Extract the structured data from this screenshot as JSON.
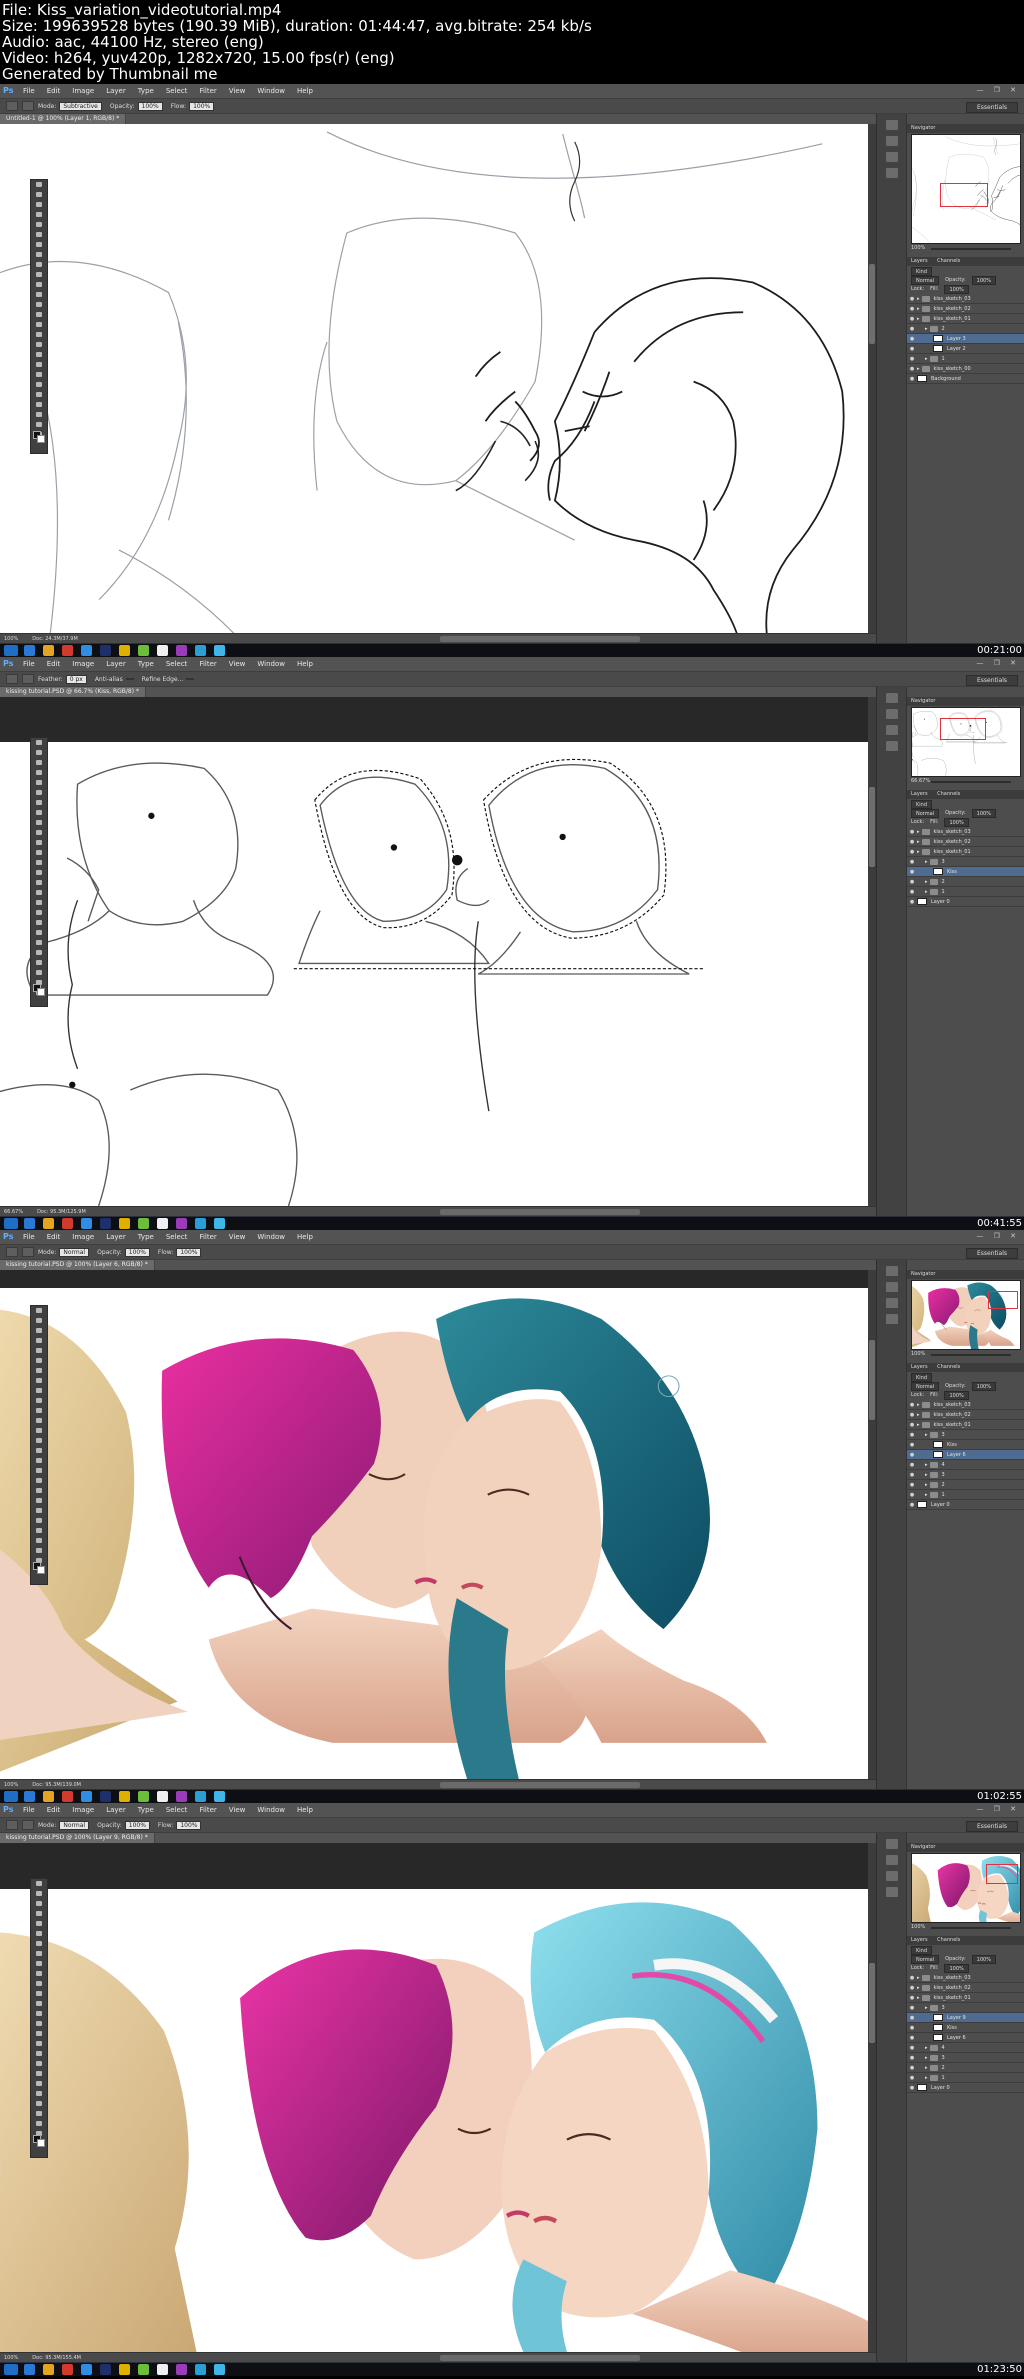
{
  "info": {
    "file": "File: Kiss_variation_videotutorial.mp4",
    "size": "Size: 199639528 bytes (190.39 MiB), duration: 01:44:47, avg.bitrate: 254 kb/s",
    "audio": "Audio: aac, 44100 Hz, stereo (eng)",
    "video": "Video: h264, yuv420p, 1282x720, 15.00 fps(r) (eng)",
    "generator": "Generated by Thumbnail me"
  },
  "menu": [
    "File",
    "Edit",
    "Image",
    "Layer",
    "Type",
    "Select",
    "Filter",
    "View",
    "Window",
    "Help"
  ],
  "app_logo": "Ps",
  "window_buttons": "— ❐ ✕",
  "workspace": "Essentials",
  "panel_tabs": {
    "navigator": "Navigator",
    "layers": "Layers",
    "channels": "Channels"
  },
  "layer_controls": {
    "kind": "Kind",
    "normal": "Normal",
    "opacity": "Opacity:",
    "opacity_val": "100%",
    "lock": "Lock:",
    "fill": "Fill:",
    "fill_val": "100%"
  },
  "taskbar_icon_colors": [
    "#2a7ad5",
    "#e3a520",
    "#d23a2e",
    "#2f8de4",
    "#1e2f6a",
    "#e0b000",
    "#6bbd3a",
    "#f0f0f0",
    "#9a3bb8",
    "#2a9fd6",
    "#3fb5e8"
  ],
  "frames": [
    {
      "timestamp": "00:21:00",
      "doc_tab": "Untitled-1 @ 100% (Layer 1, RGB/8) *",
      "options": {
        "mode_label": "Mode:",
        "mode_value": "Subtractive",
        "opacity_label": "Opacity:",
        "opacity_value": "100%",
        "flow_label": "Flow:",
        "flow_value": "100%"
      },
      "status": {
        "zoom": "100%",
        "doc": "Doc: 24.3M/37.9M"
      },
      "layers": [
        {
          "name": "kiss_sketch_03",
          "kind": "folder",
          "indent": 0,
          "selected": false
        },
        {
          "name": "kiss_sketch_02",
          "kind": "folder",
          "indent": 0,
          "selected": false
        },
        {
          "name": "kiss_sketch_01",
          "kind": "folder",
          "indent": 0,
          "selected": false
        },
        {
          "name": "2",
          "kind": "folder",
          "indent": 1,
          "selected": false
        },
        {
          "name": "Layer 3",
          "kind": "layer",
          "indent": 2,
          "selected": true
        },
        {
          "name": "Layer 2",
          "kind": "layer",
          "indent": 2,
          "selected": false
        },
        {
          "name": "1",
          "kind": "folder",
          "indent": 1,
          "selected": false
        },
        {
          "name": "kiss_sketch_00",
          "kind": "folder",
          "indent": 0,
          "selected": false
        },
        {
          "name": "Background",
          "kind": "layer",
          "indent": 0,
          "selected": false
        }
      ],
      "nav_zoom": "100%"
    },
    {
      "timestamp": "00:41:55",
      "doc_tab": "kissing tutorial.PSD @ 66.7% (Kiss, RGB/8) *",
      "options": {
        "mode_label": "Feather:",
        "mode_value": "0 px",
        "opacity_label": "Anti-alias",
        "opacity_value": "",
        "flow_label": "Refine Edge...",
        "flow_value": ""
      },
      "status": {
        "zoom": "66.67%",
        "doc": "Doc: 95.3M/125.9M"
      },
      "layers": [
        {
          "name": "kiss_sketch_03",
          "kind": "folder",
          "indent": 0,
          "selected": false
        },
        {
          "name": "kiss_sketch_02",
          "kind": "folder",
          "indent": 0,
          "selected": false
        },
        {
          "name": "kiss_sketch_01",
          "kind": "folder",
          "indent": 0,
          "selected": false
        },
        {
          "name": "3",
          "kind": "folder",
          "indent": 1,
          "selected": false
        },
        {
          "name": "Kiss",
          "kind": "layer",
          "indent": 2,
          "selected": true
        },
        {
          "name": "2",
          "kind": "folder",
          "indent": 1,
          "selected": false
        },
        {
          "name": "1",
          "kind": "folder",
          "indent": 1,
          "selected": false
        },
        {
          "name": "Layer 0",
          "kind": "layer",
          "indent": 0,
          "selected": false
        }
      ],
      "nav_zoom": "66.67%"
    },
    {
      "timestamp": "01:02:55",
      "doc_tab": "kissing tutorial.PSD @ 100% (Layer 6, RGB/8) *",
      "options": {
        "mode_label": "Mode:",
        "mode_value": "Normal",
        "opacity_label": "Opacity:",
        "opacity_value": "100%",
        "flow_label": "Flow:",
        "flow_value": "100%"
      },
      "status": {
        "zoom": "100%",
        "doc": "Doc: 95.3M/139.0M"
      },
      "layers": [
        {
          "name": "kiss_sketch_03",
          "kind": "folder",
          "indent": 0,
          "selected": false
        },
        {
          "name": "kiss_sketch_02",
          "kind": "folder",
          "indent": 0,
          "selected": false
        },
        {
          "name": "kiss_sketch_01",
          "kind": "folder",
          "indent": 0,
          "selected": false
        },
        {
          "name": "3",
          "kind": "folder",
          "indent": 1,
          "selected": false
        },
        {
          "name": "Kiss",
          "kind": "layer",
          "indent": 2,
          "selected": false
        },
        {
          "name": "Layer 6",
          "kind": "layer",
          "indent": 2,
          "selected": true
        },
        {
          "name": "4",
          "kind": "folder",
          "indent": 1,
          "selected": false
        },
        {
          "name": "3",
          "kind": "folder",
          "indent": 1,
          "selected": false
        },
        {
          "name": "2",
          "kind": "folder",
          "indent": 1,
          "selected": false
        },
        {
          "name": "1",
          "kind": "folder",
          "indent": 1,
          "selected": false
        },
        {
          "name": "Layer 0",
          "kind": "layer",
          "indent": 0,
          "selected": false
        }
      ],
      "nav_zoom": "100%"
    },
    {
      "timestamp": "01:23:50",
      "doc_tab": "kissing tutorial.PSD @ 100% (Layer 9, RGB/8) *",
      "options": {
        "mode_label": "Mode:",
        "mode_value": "Normal",
        "opacity_label": "Opacity:",
        "opacity_value": "100%",
        "flow_label": "Flow:",
        "flow_value": "100%"
      },
      "status": {
        "zoom": "100%",
        "doc": "Doc: 95.3M/155.4M"
      },
      "layers": [
        {
          "name": "kiss_sketch_03",
          "kind": "folder",
          "indent": 0,
          "selected": false
        },
        {
          "name": "kiss_sketch_02",
          "kind": "folder",
          "indent": 0,
          "selected": false
        },
        {
          "name": "kiss_sketch_01",
          "kind": "folder",
          "indent": 0,
          "selected": false
        },
        {
          "name": "3",
          "kind": "folder",
          "indent": 1,
          "selected": false
        },
        {
          "name": "Layer 9",
          "kind": "layer",
          "indent": 2,
          "selected": true
        },
        {
          "name": "Kiss",
          "kind": "layer",
          "indent": 2,
          "selected": false
        },
        {
          "name": "Layer 6",
          "kind": "layer",
          "indent": 2,
          "selected": false
        },
        {
          "name": "4",
          "kind": "folder",
          "indent": 1,
          "selected": false
        },
        {
          "name": "3",
          "kind": "folder",
          "indent": 1,
          "selected": false
        },
        {
          "name": "2",
          "kind": "folder",
          "indent": 1,
          "selected": false
        },
        {
          "name": "1",
          "kind": "folder",
          "indent": 1,
          "selected": false
        },
        {
          "name": "Layer 0",
          "kind": "layer",
          "indent": 0,
          "selected": false
        }
      ],
      "nav_zoom": "100%"
    }
  ]
}
